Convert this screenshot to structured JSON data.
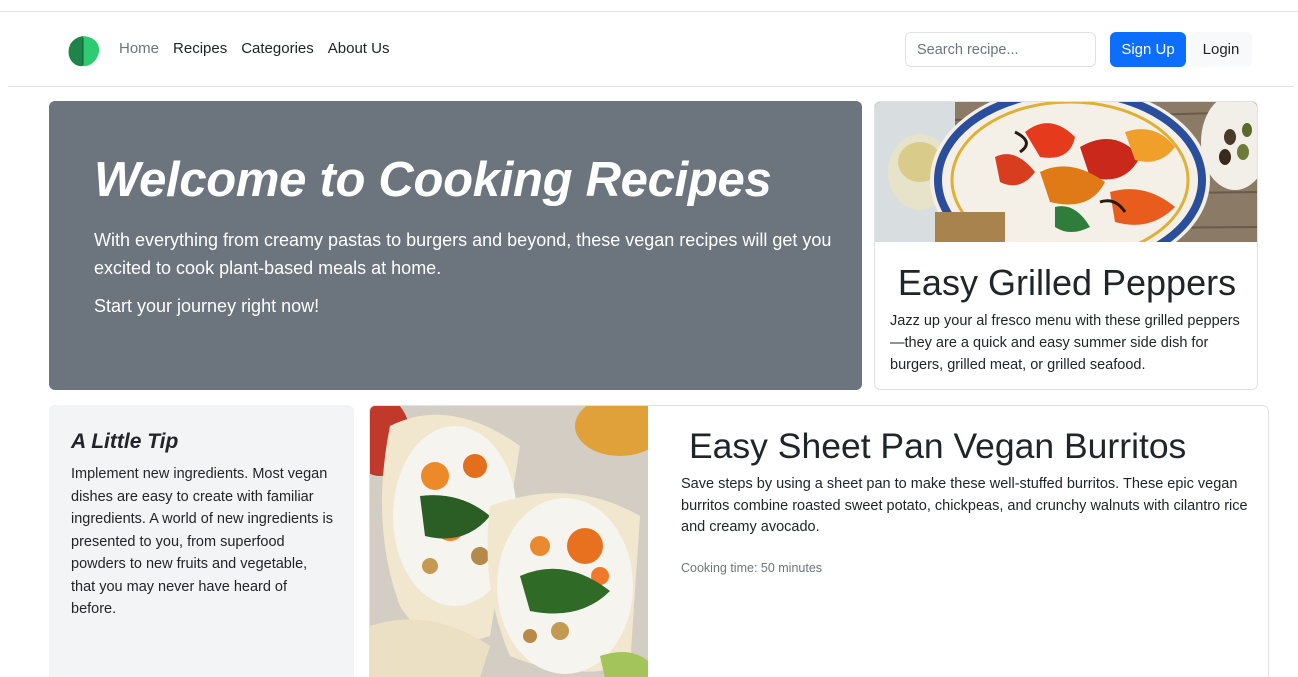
{
  "nav": {
    "links": [
      "Home",
      "Recipes",
      "Categories",
      "About Us"
    ]
  },
  "search": {
    "placeholder": "Search recipe..."
  },
  "buttons": {
    "signup": "Sign Up",
    "login": "Login"
  },
  "hero": {
    "title": "Welcome to Cooking Recipes",
    "lead": "With everything from creamy pastas to burgers and beyond, these vegan recipes will get you excited to cook plant-based meals at home.",
    "cta": "Start your journey right now!"
  },
  "featured": {
    "title": "Easy Grilled Peppers",
    "text": "Jazz up your al fresco menu with these grilled peppers—they are a quick and easy summer side dish for burgers, grilled meat, or grilled seafood."
  },
  "tip": {
    "title": "A Little Tip",
    "text": "Implement new ingredients. Most vegan dishes are easy to create with familiar ingredients. A world of new ingredients is presented to you, from superfood powders to new fruits and vegetable, that you may never have heard of before."
  },
  "recipe": {
    "title": "Easy Sheet Pan Vegan Burritos",
    "text": "Save steps by using a sheet pan to make these well-stuffed burritos. These epic vegan burritos combine roasted sweet potato, chickpeas, and crunchy walnuts with cilantro rice and creamy avocado.",
    "meta": "Cooking time: 50 minutes"
  },
  "colors": {
    "primary": "#0d6efd",
    "hero_bg": "#6c757d",
    "tip_bg": "#f3f4f6",
    "logo_dark": "#1e8449",
    "logo_light": "#2ecc71"
  },
  "icons": {
    "logo": "leaf-logo-icon"
  }
}
